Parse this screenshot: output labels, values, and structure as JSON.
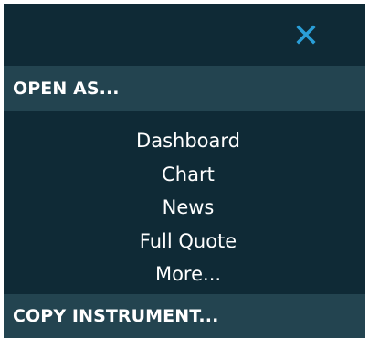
{
  "panel": {
    "close_icon": "close-x-icon",
    "close_color": "#2a9fd8",
    "open_as_header": "OPEN AS...",
    "open_as_items": [
      {
        "label": "Dashboard"
      },
      {
        "label": "Chart"
      },
      {
        "label": "News"
      },
      {
        "label": "Full Quote"
      },
      {
        "label": "More..."
      }
    ],
    "copy_instrument_header": "COPY INSTRUMENT..."
  },
  "colors": {
    "panel_bg": "#0f2a36",
    "header_bg": "#234450",
    "text": "#ffffff",
    "accent": "#2a9fd8"
  }
}
